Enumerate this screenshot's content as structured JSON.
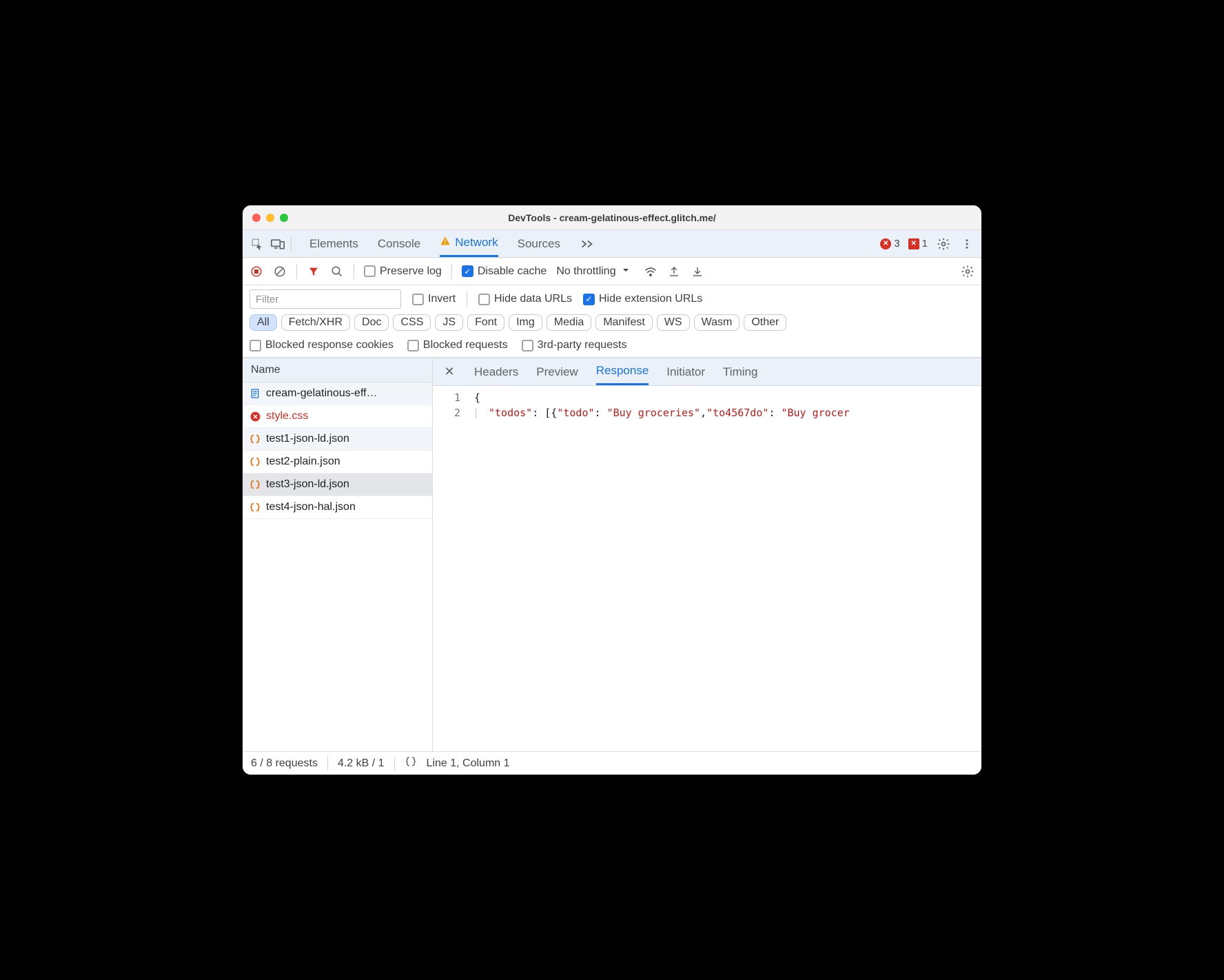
{
  "window": {
    "title": "DevTools - cream-gelatinous-effect.glitch.me/"
  },
  "tabs": {
    "items": [
      "Elements",
      "Console",
      "Network",
      "Sources"
    ],
    "active": "Network",
    "warning_on": "Network",
    "error_count": "3",
    "issue_count": "1"
  },
  "toolbar": {
    "preserve_log_label": "Preserve log",
    "preserve_log_checked": false,
    "disable_cache_label": "Disable cache",
    "disable_cache_checked": true,
    "throttling_label": "No throttling"
  },
  "filter": {
    "placeholder": "Filter",
    "invert_label": "Invert",
    "invert_checked": false,
    "hide_data_label": "Hide data URLs",
    "hide_data_checked": false,
    "hide_ext_label": "Hide extension URLs",
    "hide_ext_checked": true
  },
  "types": {
    "items": [
      "All",
      "Fetch/XHR",
      "Doc",
      "CSS",
      "JS",
      "Font",
      "Img",
      "Media",
      "Manifest",
      "WS",
      "Wasm",
      "Other"
    ],
    "active": "All"
  },
  "advanced": {
    "blocked_cookies_label": "Blocked response cookies",
    "blocked_requests_label": "Blocked requests",
    "third_party_label": "3rd-party requests"
  },
  "request_list": {
    "header": "Name",
    "items": [
      {
        "name": "cream-gelatinous-eff…",
        "icon": "document-icon",
        "state": "alt"
      },
      {
        "name": "style.css",
        "icon": "error-icon",
        "state": "error"
      },
      {
        "name": "test1-json-ld.json",
        "icon": "json-icon",
        "state": "alt"
      },
      {
        "name": "test2-plain.json",
        "icon": "json-icon",
        "state": ""
      },
      {
        "name": "test3-json-ld.json",
        "icon": "json-icon",
        "state": "selected"
      },
      {
        "name": "test4-json-hal.json",
        "icon": "json-icon",
        "state": ""
      }
    ]
  },
  "detail_tabs": {
    "items": [
      "Headers",
      "Preview",
      "Response",
      "Initiator",
      "Timing"
    ],
    "active": "Response"
  },
  "code": {
    "line_numbers": [
      "1",
      "2"
    ],
    "line1": "{",
    "line2_seg1": "\"todos\"",
    "line2_seg2": ": [{",
    "line2_seg3": "\"todo\"",
    "line2_seg4": ": ",
    "line2_seg5": "\"Buy groceries\"",
    "line2_seg6": ",",
    "line2_seg7": "\"to4567do\"",
    "line2_seg8": ": ",
    "line2_seg9": "\"Buy grocer"
  },
  "status": {
    "requests": "6 / 8 requests",
    "transfer": "4.2 kB / 1",
    "cursor": "Line 1, Column 1"
  }
}
